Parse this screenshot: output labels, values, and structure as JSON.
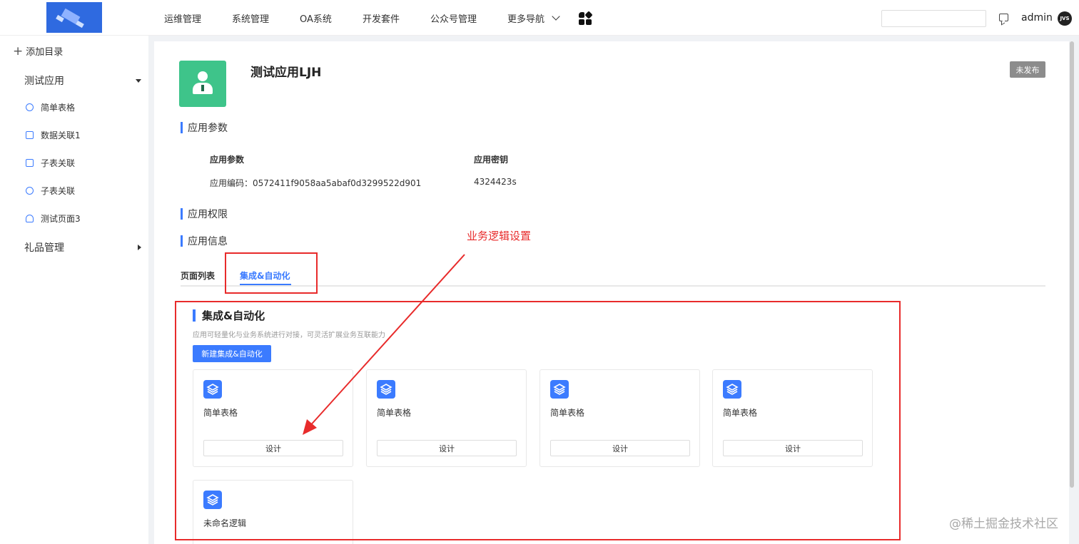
{
  "topbar": {
    "nav": [
      "运维管理",
      "系统管理",
      "OA系统",
      "开发套件",
      "公众号管理"
    ],
    "more_nav": "更多导航",
    "search_value": "",
    "admin": "admin",
    "avatar": "JVS"
  },
  "sidebar": {
    "add_dir": "添加目录",
    "groups": [
      {
        "label": "测试应用",
        "items": [
          "简单表格",
          "数据关联1",
          "子表关联",
          "子表关联",
          "测试页面3"
        ]
      },
      {
        "label": "礼品管理"
      }
    ]
  },
  "app": {
    "title": "测试应用LJH",
    "status": "未发布",
    "sections": [
      "应用参数",
      "应用权限",
      "应用信息"
    ],
    "params": {
      "head_left": "应用参数",
      "head_right": "应用密钥",
      "val_left": "应用编码：0572411f9058aa5abaf0d3299522d901",
      "val_right": "4324423s"
    },
    "tabs": [
      "页面列表",
      "集成&自动化"
    ],
    "active_tab": "集成&自动化"
  },
  "integration": {
    "title": "集成&自动化",
    "desc": "应用可轻量化与业务系统进行对接，可灵活扩展业务互联能力",
    "new_button": "新建集成&自动化",
    "cards": [
      {
        "name": "简单表格",
        "button": "设计"
      },
      {
        "name": "简单表格",
        "button": "设计"
      },
      {
        "name": "简单表格",
        "button": "设计"
      },
      {
        "name": "简单表格",
        "button": "设计"
      },
      {
        "name": "未命名逻辑"
      }
    ]
  },
  "annotation": {
    "label": "业务逻辑设置",
    "color": "#e82b2b"
  },
  "watermark": "@稀土掘金技术社区"
}
